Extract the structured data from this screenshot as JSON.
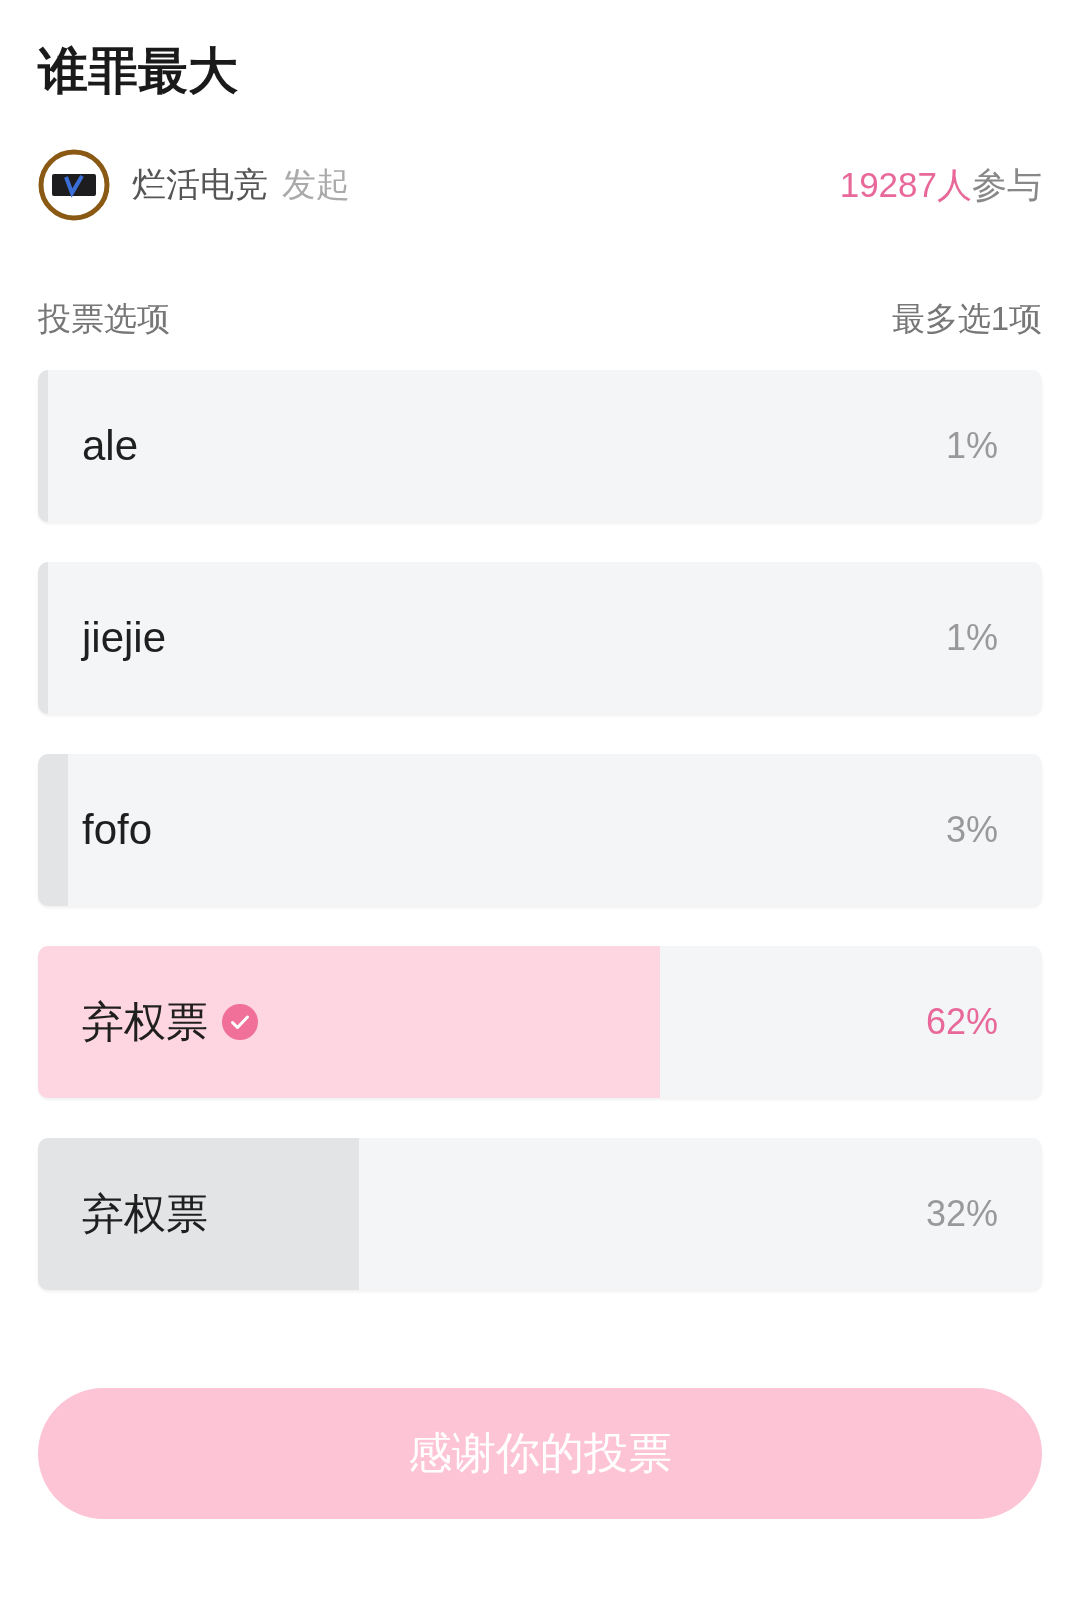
{
  "poll": {
    "title": "谁罪最大"
  },
  "initiator": {
    "name": "烂活电竞",
    "action": "发起"
  },
  "participants": {
    "count": "19287人",
    "suffix": "参与"
  },
  "options_header": {
    "label": "投票选项",
    "limit": "最多选1项"
  },
  "options": [
    {
      "label": "ale",
      "percent": "1%",
      "level": 0.01,
      "selected": false
    },
    {
      "label": "jiejie",
      "percent": "1%",
      "level": 0.01,
      "selected": false
    },
    {
      "label": "fofo",
      "percent": "3%",
      "level": 0.03,
      "selected": false
    },
    {
      "label": "弃权票",
      "percent": "62%",
      "level": 0.62,
      "selected": true
    },
    {
      "label": "弃权票",
      "percent": "32%",
      "level": 0.32,
      "selected": false
    }
  ],
  "submit_button": {
    "label": "感谢你的投票",
    "disabled": true
  }
}
